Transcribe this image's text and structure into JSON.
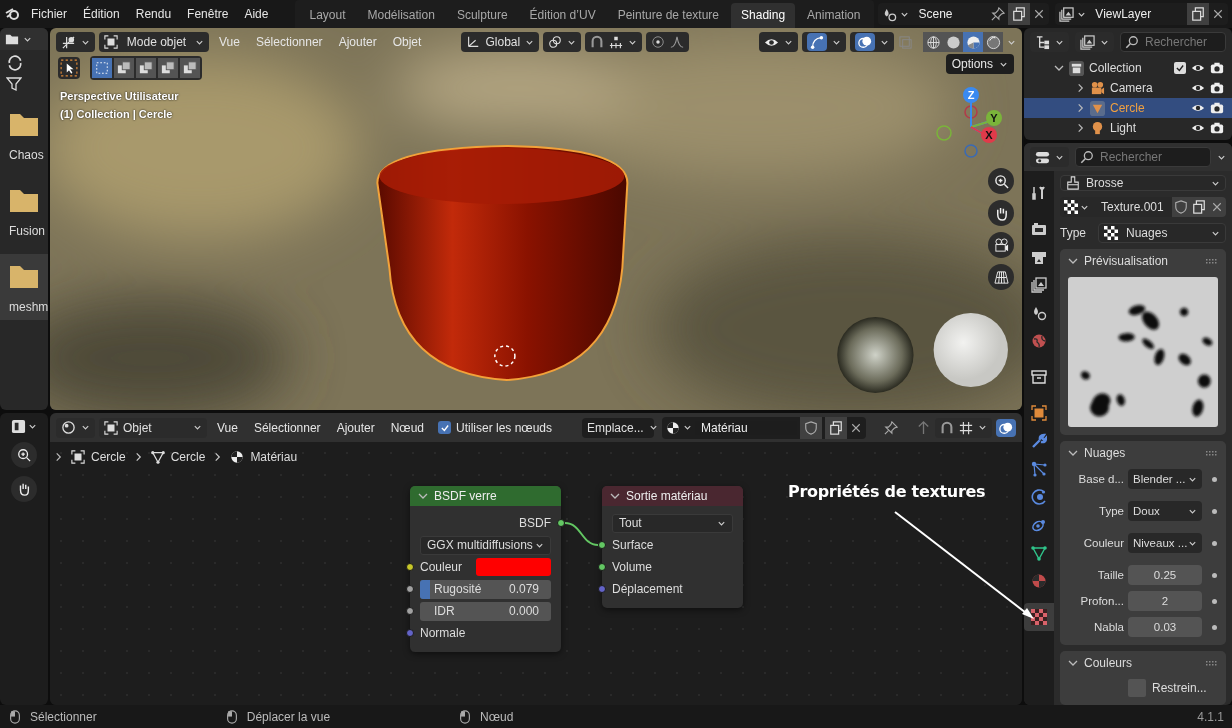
{
  "menu": [
    "Fichier",
    "Édition",
    "Rendu",
    "Fenêtre",
    "Aide"
  ],
  "workspaces": [
    {
      "label": "Layout",
      "selected": false
    },
    {
      "label": "Modélisation",
      "selected": false
    },
    {
      "label": "Sculpture",
      "selected": false
    },
    {
      "label": "Édition d’UV",
      "selected": false
    },
    {
      "label": "Peinture de texture",
      "selected": false
    },
    {
      "label": "Shading",
      "selected": true
    },
    {
      "label": "Animation",
      "selected": false
    }
  ],
  "scene": {
    "name": "Scene"
  },
  "view_layer": {
    "name": "ViewLayer"
  },
  "file_browser": {
    "items": [
      {
        "label": "Chaos",
        "selected": false
      },
      {
        "label": "Fusion",
        "selected": false
      },
      {
        "label": "meshm",
        "selected": true
      }
    ]
  },
  "viewport": {
    "mode": "Mode objet",
    "menus": [
      "Vue",
      "Sélectionner",
      "Ajouter",
      "Objet"
    ],
    "orientation": "Global",
    "options": "Options",
    "gizmos_on": true,
    "overlays_on": true,
    "info": [
      "Perspective Utilisateur",
      "(1) Collection | Cercle"
    ],
    "gizmo_axes": [
      "Z",
      "Y",
      "X"
    ],
    "shading": [
      {
        "kind": "wireframe",
        "selected": false
      },
      {
        "kind": "solid",
        "selected": false
      },
      {
        "kind": "material",
        "selected": true
      },
      {
        "kind": "rendered",
        "selected": false
      }
    ]
  },
  "outliner": {
    "search_placeholder": "Rechercher",
    "tree": [
      {
        "label": "Collection",
        "kind": "collection",
        "expanded": true,
        "checked": true,
        "selected": false,
        "children": [
          {
            "label": "Camera",
            "kind": "camera",
            "expanded": false,
            "selected": false
          },
          {
            "label": "Cercle",
            "kind": "mesh",
            "expanded": false,
            "selected": true
          },
          {
            "label": "Light",
            "kind": "light",
            "expanded": false,
            "selected": false
          }
        ]
      }
    ]
  },
  "properties": {
    "search_placeholder": "Rechercher",
    "tabs": [
      {
        "kind": "tool",
        "selected": false
      },
      {
        "kind": "render",
        "selected": false
      },
      {
        "kind": "output",
        "selected": false
      },
      {
        "kind": "view_layer",
        "selected": false
      },
      {
        "kind": "scene",
        "selected": false
      },
      {
        "kind": "world",
        "selected": false
      },
      {
        "kind": "collection",
        "selected": false
      },
      {
        "kind": "object",
        "selected": false
      },
      {
        "kind": "modifier",
        "selected": false
      },
      {
        "kind": "particles",
        "selected": false
      },
      {
        "kind": "physics",
        "selected": false
      },
      {
        "kind": "constraints",
        "selected": false
      },
      {
        "kind": "data",
        "selected": false
      },
      {
        "kind": "material",
        "selected": false
      },
      {
        "kind": "texture",
        "selected": true
      }
    ],
    "brush": "Brosse",
    "texture_name": "Texture.001",
    "type_label": "Type",
    "type_value": "Nuages",
    "panels": [
      {
        "title": "Prévisualisation",
        "expanded": true,
        "kind": "preview"
      },
      {
        "title": "Nuages",
        "expanded": true,
        "kind": "fields",
        "rows": [
          {
            "kind": "dropdown",
            "label": "Base d...",
            "value": "Blender ..."
          },
          {
            "kind": "dropdown",
            "label": "Type",
            "value": "Doux"
          },
          {
            "kind": "dropdown",
            "label": "Couleur",
            "value": "Niveaux ..."
          },
          {
            "kind": "number",
            "label": "Taille",
            "value": "0.25"
          },
          {
            "kind": "number",
            "label": "Profon...",
            "value": "2"
          },
          {
            "kind": "number",
            "label": "Nabla",
            "value": "0.03"
          }
        ]
      },
      {
        "title": "Couleurs",
        "expanded": true,
        "kind": "fields",
        "rows": [
          {
            "kind": "checkbox",
            "label": "Restrein...",
            "checked": false
          }
        ]
      }
    ]
  },
  "node_editor": {
    "type": "Objet",
    "menus": [
      "Vue",
      "Sélectionner",
      "Ajouter",
      "Nœud"
    ],
    "use_nodes": {
      "label": "Utiliser les nœuds",
      "checked": true
    },
    "slot": "Emplace...",
    "material": "Matériau",
    "breadcrumbs": [
      "Cercle",
      "Cercle",
      "Matériau"
    ],
    "nodes": [
      {
        "title": "BSDF verre",
        "color": "#2f6b2f",
        "rows": [
          {
            "kind": "output",
            "label": "BSDF",
            "socket": {
              "color": "#63c763"
            }
          },
          {
            "kind": "dropdown",
            "value": "GGX multidiffusions"
          },
          {
            "kind": "color",
            "label": "Couleur",
            "socket": {
              "color": "#c7c729"
            },
            "color": "#ff0000"
          },
          {
            "kind": "slider",
            "label": "Rugosité",
            "value": "0.079",
            "level": 0.079,
            "socket": {
              "color": "#a1a1a1"
            }
          },
          {
            "kind": "slider",
            "label": "IDR",
            "value": "0.000",
            "socket": {
              "color": "#a1a1a1"
            }
          },
          {
            "kind": "input",
            "label": "Normale",
            "socket": {
              "color": "#6363c7"
            }
          }
        ]
      },
      {
        "title": "Sortie matériau",
        "color": "#4a2730",
        "rows": [
          {
            "kind": "dropdown",
            "value": "Tout"
          },
          {
            "kind": "input",
            "label": "Surface",
            "socket": {
              "color": "#63c763"
            },
            "linked": true
          },
          {
            "kind": "input",
            "label": "Volume",
            "socket": {
              "color": "#63c763"
            }
          },
          {
            "kind": "input",
            "label": "Déplacement",
            "socket": {
              "color": "#6363c7"
            }
          }
        ]
      }
    ],
    "annotation": "Propriétés de textures"
  },
  "status_bar": {
    "items": [
      "Sélectionner",
      "Déplacer la vue",
      "Nœud"
    ],
    "version": "4.1.1"
  }
}
